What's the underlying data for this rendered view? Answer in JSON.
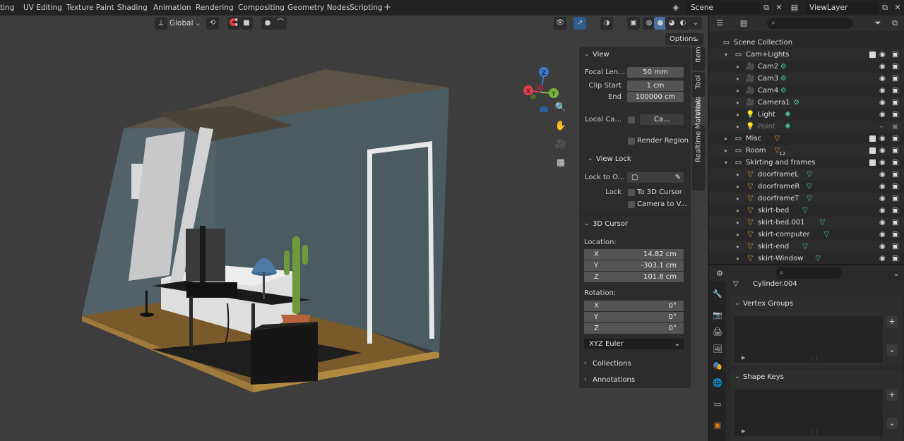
{
  "workspace_tabs": [
    "ting",
    "UV Editing",
    "Texture Paint",
    "Shading",
    "Animation",
    "Rendering",
    "Compositing",
    "Geometry Nodes",
    "Scripting"
  ],
  "add_tab": "+",
  "scene": {
    "name": "Scene",
    "view_layer": "ViewLayer"
  },
  "viewport": {
    "transform_orientation": "Global",
    "options_label": "Options",
    "gizmo_axes": {
      "x": "X",
      "y": "Y",
      "z": "Z"
    }
  },
  "npanel": {
    "tabs": [
      "Item",
      "Tool",
      "View",
      "Realtime Materials"
    ],
    "view": {
      "title": "View",
      "focal_label": "Focal Len...",
      "focal_value": "50 mm",
      "clip_start_label": "Clip Start",
      "clip_start_value": "1 cm",
      "end_label": "End",
      "end_value": "100000 cm",
      "local_cam_label": "Local Ca...",
      "local_cam_value": "Ca...",
      "render_region": "Render Region"
    },
    "view_lock": {
      "title": "View Lock",
      "lock_to_label": "Lock to O...",
      "lock_label": "Lock",
      "to_cursor": "To 3D Cursor",
      "camera_to_view": "Camera to V..."
    },
    "cursor": {
      "title": "3D Cursor",
      "location_label": "Location:",
      "x_label": "X",
      "x_value": "14.82 cm",
      "y_label": "Y",
      "y_value": "-303.1 cm",
      "z_label": "Z",
      "z_value": "101.8 cm",
      "rotation_label": "Rotation:",
      "rx_label": "X",
      "rx_value": "0°",
      "ry_label": "Y",
      "ry_value": "0°",
      "rz_label": "Z",
      "rz_value": "0°",
      "rotation_mode": "XYZ Euler"
    },
    "collections": "Collections",
    "annotations": "Annotations"
  },
  "outliner": {
    "rows": [
      {
        "name": "Scene Collection",
        "level": 0,
        "icon": "scene-collection-icon"
      },
      {
        "name": "Cam+Lights",
        "level": 1,
        "icon": "collection-icon",
        "expanded": true
      },
      {
        "name": "Cam2",
        "level": 2,
        "icon": "camera-object-icon"
      },
      {
        "name": "Cam3",
        "level": 2,
        "icon": "camera-object-icon"
      },
      {
        "name": "Cam4",
        "level": 2,
        "icon": "camera-object-icon"
      },
      {
        "name": "Camera1",
        "level": 2,
        "icon": "camera-object-icon"
      },
      {
        "name": "Light",
        "level": 2,
        "icon": "light-object-icon"
      },
      {
        "name": "Point",
        "level": 2,
        "icon": "light-object-icon",
        "dim": true
      },
      {
        "name": "Misc",
        "level": 1,
        "icon": "collection-icon"
      },
      {
        "name": "Room",
        "level": 1,
        "icon": "collection-icon",
        "badge": "12"
      },
      {
        "name": "Skirting and frames",
        "level": 1,
        "icon": "collection-icon",
        "expanded": true
      },
      {
        "name": "doorframeL",
        "level": 2,
        "icon": "mesh-object-icon"
      },
      {
        "name": "doorframeR",
        "level": 2,
        "icon": "mesh-object-icon"
      },
      {
        "name": "doorframeT",
        "level": 2,
        "icon": "mesh-object-icon"
      },
      {
        "name": "skirt-bed",
        "level": 2,
        "icon": "mesh-object-icon"
      },
      {
        "name": "skirt-bed.001",
        "level": 2,
        "icon": "mesh-object-icon"
      },
      {
        "name": "skirt-computer",
        "level": 2,
        "icon": "mesh-object-icon"
      },
      {
        "name": "skirt-end",
        "level": 2,
        "icon": "mesh-object-icon"
      },
      {
        "name": "skirt-Window",
        "level": 2,
        "icon": "mesh-object-icon"
      }
    ]
  },
  "properties": {
    "object_name": "Cylinder.004",
    "vertex_groups": "Vertex Groups",
    "shape_keys": "Shape Keys",
    "add": "+"
  }
}
